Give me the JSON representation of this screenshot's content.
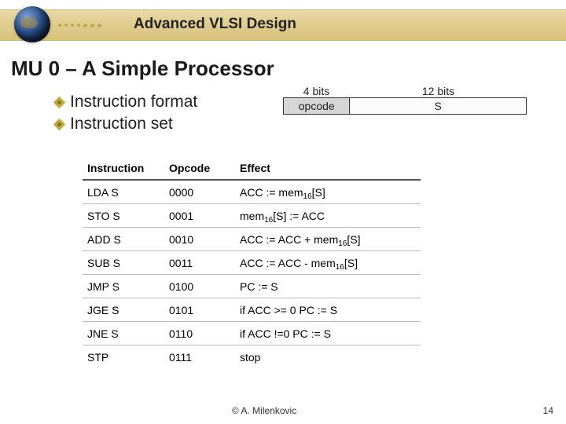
{
  "header": {
    "course_title": "Advanced VLSI Design"
  },
  "slide": {
    "title": "MU 0 – A Simple Processor",
    "bullets": [
      "Instruction format",
      "Instruction set"
    ]
  },
  "format": {
    "fields": [
      {
        "bits": "4 bits",
        "name": "opcode"
      },
      {
        "bits": "12 bits",
        "name": "S"
      }
    ]
  },
  "table": {
    "headers": [
      "Instruction",
      "Opcode",
      "Effect"
    ],
    "rows": [
      {
        "instr": "LDA S",
        "opcode": "0000",
        "effect": "ACC := mem₁₆[S]"
      },
      {
        "instr": "STO S",
        "opcode": "0001",
        "effect": "mem₁₆[S] := ACC"
      },
      {
        "instr": "ADD S",
        "opcode": "0010",
        "effect": "ACC := ACC + mem₁₆[S]"
      },
      {
        "instr": "SUB S",
        "opcode": "0011",
        "effect": "ACC := ACC - mem₁₆[S]"
      },
      {
        "instr": "JMP S",
        "opcode": "0100",
        "effect": "PC := S"
      },
      {
        "instr": "JGE S",
        "opcode": "0101",
        "effect": "if  ACC >= 0 PC := S"
      },
      {
        "instr": "JNE S",
        "opcode": "0110",
        "effect": "if  ACC !=0 PC := S"
      },
      {
        "instr": "STP",
        "opcode": "0111",
        "effect": "stop"
      }
    ]
  },
  "footer": {
    "author": "©  A. Milenkovic",
    "page": "14"
  }
}
